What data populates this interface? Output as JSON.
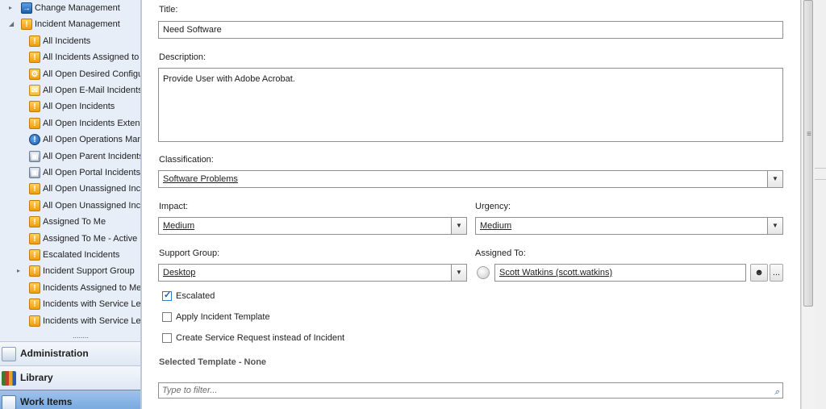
{
  "sidebar": {
    "tree": [
      {
        "label": "Change Management",
        "icon": "change-management-icon",
        "icon_class": "blue",
        "glyph": "→",
        "expander": "▸",
        "level": 0
      },
      {
        "label": "Incident Management",
        "icon": "incident-management-icon",
        "icon_class": "excl",
        "glyph": "!",
        "expander": "◢",
        "level": 0
      },
      {
        "label": "All Incidents",
        "icon": "incident-icon",
        "icon_class": "excl",
        "glyph": "!",
        "level": 1
      },
      {
        "label": "All Incidents Assigned to",
        "icon": "incident-icon",
        "icon_class": "excl",
        "glyph": "!",
        "level": 1
      },
      {
        "label": "All Open Desired Configu",
        "icon": "desired-config-icon",
        "icon_class": "gear",
        "glyph": "⚙",
        "level": 1
      },
      {
        "label": "All Open E-Mail Incidents",
        "icon": "email-icon",
        "icon_class": "mail",
        "glyph": "✉",
        "level": 1
      },
      {
        "label": "All Open Incidents",
        "icon": "incident-icon",
        "icon_class": "excl",
        "glyph": "!",
        "level": 1
      },
      {
        "label": "All Open Incidents Extend",
        "icon": "incident-icon",
        "icon_class": "excl",
        "glyph": "!",
        "level": 1
      },
      {
        "label": "All Open Operations Man",
        "icon": "operations-manager-icon",
        "icon_class": "ops",
        "glyph": "!",
        "level": 1
      },
      {
        "label": "All Open Parent Incidents",
        "icon": "parent-incident-icon",
        "icon_class": "parent",
        "glyph": "▣",
        "level": 1
      },
      {
        "label": "All Open Portal Incidents",
        "icon": "portal-incident-icon",
        "icon_class": "parent",
        "glyph": "▣",
        "level": 1
      },
      {
        "label": "All Open Unassigned Inci",
        "icon": "incident-icon",
        "icon_class": "excl",
        "glyph": "!",
        "level": 1
      },
      {
        "label": "All Open Unassigned Inci",
        "icon": "incident-icon",
        "icon_class": "excl",
        "glyph": "!",
        "level": 1
      },
      {
        "label": "Assigned To Me",
        "icon": "assigned-incident-icon",
        "icon_class": "excl",
        "glyph": "!",
        "level": 1
      },
      {
        "label": "Assigned To Me - Active",
        "icon": "assigned-incident-icon",
        "icon_class": "excl",
        "glyph": "!",
        "level": 1
      },
      {
        "label": "Escalated Incidents",
        "icon": "escalated-incident-icon",
        "icon_class": "excl",
        "glyph": "!",
        "level": 1
      },
      {
        "label": "Incident Support Group",
        "icon": "incident-icon",
        "icon_class": "excl",
        "glyph": "!",
        "expander": "▸",
        "level": 1
      },
      {
        "label": "Incidents Assigned to Me",
        "icon": "incident-icon",
        "icon_class": "excl",
        "glyph": "!",
        "level": 1
      },
      {
        "label": "Incidents with Service Lev",
        "icon": "sla-warning-icon",
        "icon_class": "excl",
        "glyph": "!",
        "level": 1
      },
      {
        "label": "Incidents with Service Lev",
        "icon": "sla-warning-icon",
        "icon_class": "excl",
        "glyph": "!",
        "level": 1
      }
    ],
    "more_dots": "........",
    "nav": {
      "administration": "Administration",
      "library": "Library",
      "work_items": "Work Items"
    }
  },
  "form": {
    "title_label": "Title:",
    "title_value": "Need Software",
    "description_label": "Description:",
    "description_value": "Provide User with Adobe Acrobat.",
    "classification_label": "Classification:",
    "classification_value": "Software Problems",
    "impact_label": "Impact:",
    "impact_value": "Medium",
    "urgency_label": "Urgency:",
    "urgency_value": "Medium",
    "support_group_label": "Support Group:",
    "support_group_value": "Desktop",
    "assigned_to_label": "Assigned To:",
    "assigned_to_value": "Scott Watkins (scott.watkins)",
    "browse_button_label": "...",
    "escalated_label": "Escalated",
    "escalated_checked": true,
    "apply_template_label": "Apply Incident Template",
    "apply_template_checked": false,
    "create_sr_label": "Create Service Request instead of Incident",
    "create_sr_checked": false,
    "selected_template_label": "Selected Template - None",
    "filter_placeholder": "Type to filter...",
    "dropdown_glyph": "▼",
    "check_glyph": "✓",
    "search_glyph": "⌕"
  },
  "scrollbar": {
    "grip": "≡"
  },
  "colors": {
    "sidebar_bg": "#e7eef8",
    "selected_nav": "#6fa3dd",
    "incident_icon": "#ef9d10",
    "link_blue": "#2b5f9f"
  }
}
